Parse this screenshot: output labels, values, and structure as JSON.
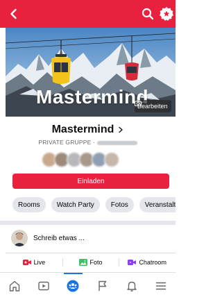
{
  "colors": {
    "brand": "#e8213f",
    "active_nav": "#1b74e4",
    "live_red": "#e8213f",
    "photo_green": "#45bd62",
    "chatroom_purple": "#8b3dff"
  },
  "topbar": {
    "back_icon": "chevron-left-icon",
    "search_icon": "search-icon",
    "badge_icon": "group-badge-icon"
  },
  "cover": {
    "title": "Mastermind",
    "edit_label": "Bearbeiten",
    "edit_icon": "camera-icon"
  },
  "group": {
    "name": "Mastermind",
    "privacy": "PRIVATE GRUPPE · ",
    "member_avatars": [
      "#c9a98d",
      "#9b8a7a",
      "#b6b8bb",
      "#a7988b",
      "#8fa0b3",
      "#c4b6ab"
    ]
  },
  "invite_label": "Einladen",
  "tabs": [
    "Rooms",
    "Watch Party",
    "Fotos",
    "Veranstaltungen"
  ],
  "composer": {
    "placeholder": "Schreib etwas ..."
  },
  "actions": {
    "live": "Live",
    "photo": "Foto",
    "chatroom": "Chatroom"
  },
  "bottom_nav": [
    {
      "icon": "home-icon",
      "active": false
    },
    {
      "icon": "video-icon",
      "active": false
    },
    {
      "icon": "groups-icon",
      "active": true
    },
    {
      "icon": "flag-icon",
      "active": false
    },
    {
      "icon": "bell-icon",
      "active": false
    },
    {
      "icon": "menu-icon",
      "active": false
    }
  ]
}
